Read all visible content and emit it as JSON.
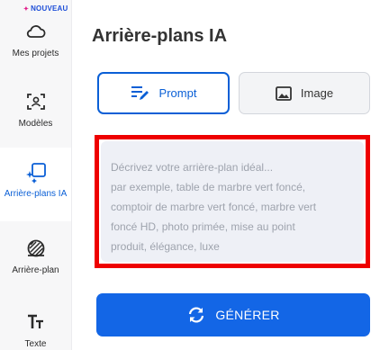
{
  "sidebar": {
    "badge": "NOUVEAU",
    "items": [
      {
        "label": "Mes projets",
        "icon": "cloud-icon"
      },
      {
        "label": "Modèles",
        "icon": "template-icon"
      },
      {
        "label": "Arrière-plans IA",
        "icon": "ai-background-icon",
        "active": true
      },
      {
        "label": "Arrière-plan",
        "icon": "background-pattern-icon"
      },
      {
        "label": "Texte",
        "icon": "text-icon"
      }
    ]
  },
  "main": {
    "title": "Arrière-plans IA",
    "modes": [
      {
        "label": "Prompt",
        "icon": "edit-lines-icon",
        "selected": true
      },
      {
        "label": "Image",
        "icon": "image-icon",
        "selected": false
      }
    ],
    "prompt_lines": [
      "Décrivez votre arrière-plan idéal...",
      "par exemple, table de marbre vert foncé,",
      "comptoir de marbre vert foncé, marbre vert",
      "foncé HD, photo primée, mise au point",
      "produit, élégance, luxe"
    ],
    "generate_label": "GÉNÉRER"
  },
  "colors": {
    "accent": "#1366e6",
    "highlight_border": "#ee0000",
    "badge": "#1d4ed8"
  }
}
